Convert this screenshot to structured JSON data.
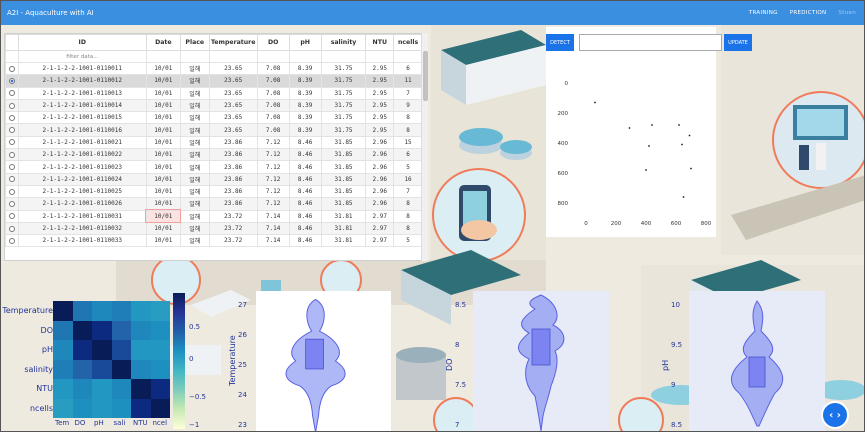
{
  "app": {
    "title": "A2I - Aquaculture with AI"
  },
  "nav": {
    "training": "TRAINING",
    "prediction": "PREDICTION",
    "user": "Stuen"
  },
  "table": {
    "columns": [
      "",
      "ID",
      "Date",
      "Place",
      "Temperature",
      "DO",
      "pH",
      "salinity",
      "NTU",
      "ncells"
    ],
    "filter_placeholder": "filter data...",
    "rows": [
      {
        "id": "2-1-1-2-2-1001-0110011",
        "date": "10/01",
        "place": "일해",
        "temperature": "23.65",
        "do": "7.08",
        "ph": "8.39",
        "salinity": "31.75",
        "ntu": "2.95",
        "ncells": "6"
      },
      {
        "id": "2-1-1-2-2-1001-0110012",
        "date": "10/01",
        "place": "일해",
        "temperature": "23.65",
        "do": "7.08",
        "ph": "8.39",
        "salinity": "31.75",
        "ntu": "2.95",
        "ncells": "11"
      },
      {
        "id": "2-1-1-2-2-1001-0110013",
        "date": "10/01",
        "place": "일해",
        "temperature": "23.65",
        "do": "7.08",
        "ph": "8.39",
        "salinity": "31.75",
        "ntu": "2.95",
        "ncells": "7"
      },
      {
        "id": "2-1-1-2-2-1001-0110014",
        "date": "10/01",
        "place": "일해",
        "temperature": "23.65",
        "do": "7.08",
        "ph": "8.39",
        "salinity": "31.75",
        "ntu": "2.95",
        "ncells": "9"
      },
      {
        "id": "2-1-1-2-2-1001-0110015",
        "date": "10/01",
        "place": "일해",
        "temperature": "23.65",
        "do": "7.08",
        "ph": "8.39",
        "salinity": "31.75",
        "ntu": "2.95",
        "ncells": "8"
      },
      {
        "id": "2-1-1-2-2-1001-0110016",
        "date": "10/01",
        "place": "일해",
        "temperature": "23.65",
        "do": "7.08",
        "ph": "8.39",
        "salinity": "31.75",
        "ntu": "2.95",
        "ncells": "8"
      },
      {
        "id": "2-1-1-2-2-1001-0110021",
        "date": "10/01",
        "place": "일해",
        "temperature": "23.86",
        "do": "7.12",
        "ph": "8.46",
        "salinity": "31.85",
        "ntu": "2.96",
        "ncells": "15"
      },
      {
        "id": "2-1-1-2-2-1001-0110022",
        "date": "10/01",
        "place": "일해",
        "temperature": "23.86",
        "do": "7.12",
        "ph": "8.46",
        "salinity": "31.85",
        "ntu": "2.96",
        "ncells": "6"
      },
      {
        "id": "2-1-1-2-2-1001-0110023",
        "date": "10/01",
        "place": "일해",
        "temperature": "23.86",
        "do": "7.12",
        "ph": "8.46",
        "salinity": "31.85",
        "ntu": "2.96",
        "ncells": "5"
      },
      {
        "id": "2-1-1-2-2-1001-0110024",
        "date": "10/01",
        "place": "일해",
        "temperature": "23.86",
        "do": "7.12",
        "ph": "8.46",
        "salinity": "31.85",
        "ntu": "2.96",
        "ncells": "16"
      },
      {
        "id": "2-1-1-2-2-1001-0110025",
        "date": "10/01",
        "place": "일해",
        "temperature": "23.86",
        "do": "7.12",
        "ph": "8.46",
        "salinity": "31.85",
        "ntu": "2.96",
        "ncells": "7"
      },
      {
        "id": "2-1-1-2-2-1001-0110026",
        "date": "10/01",
        "place": "일해",
        "temperature": "23.86",
        "do": "7.12",
        "ph": "8.46",
        "salinity": "31.85",
        "ntu": "2.96",
        "ncells": "8"
      },
      {
        "id": "2-1-1-2-2-1001-0110031",
        "date": "10/01",
        "place": "일해",
        "temperature": "23.72",
        "do": "7.14",
        "ph": "8.46",
        "salinity": "31.81",
        "ntu": "2.97",
        "ncells": "8"
      },
      {
        "id": "2-1-1-2-2-1001-0110032",
        "date": "10/01",
        "place": "일해",
        "temperature": "23.72",
        "do": "7.14",
        "ph": "8.46",
        "salinity": "31.81",
        "ntu": "2.97",
        "ncells": "8"
      },
      {
        "id": "2-1-1-2-2-1001-0110033",
        "date": "10/01",
        "place": "일해",
        "temperature": "23.72",
        "do": "7.14",
        "ph": "8.46",
        "salinity": "31.81",
        "ntu": "2.97",
        "ncells": "5"
      }
    ],
    "selected_row": 1
  },
  "detect": {
    "detect_label": "DETECT",
    "update_label": "UPDATE",
    "input_value": ""
  },
  "scatter": {
    "x_ticks": [
      "0",
      "200",
      "400",
      "600",
      "800"
    ],
    "y_ticks": [
      "0",
      "200",
      "400",
      "600",
      "800"
    ],
    "points": [
      [
        60,
        130
      ],
      [
        290,
        300
      ],
      [
        440,
        280
      ],
      [
        620,
        280
      ],
      [
        420,
        420
      ],
      [
        640,
        410
      ],
      [
        690,
        350
      ],
      [
        400,
        580
      ],
      [
        700,
        570
      ],
      [
        650,
        760
      ]
    ]
  },
  "heatmap": {
    "labels": [
      "Temperature",
      "DO",
      "pH",
      "salinity",
      "NTU",
      "ncells"
    ],
    "x_labels": [
      "Tem",
      "DO",
      "pH",
      "sali",
      "NTU",
      "ncel"
    ],
    "colorbar_ticks": [
      "0.5",
      "0",
      "−0.5",
      "−1"
    ],
    "values": [
      [
        1,
        0.3,
        0.2,
        0.25,
        0.1,
        0.05
      ],
      [
        0.3,
        1,
        0.75,
        0.4,
        0.2,
        0.15
      ],
      [
        0.2,
        0.75,
        1,
        0.55,
        0.1,
        0.1
      ],
      [
        0.25,
        0.4,
        0.55,
        1,
        0.2,
        0.15
      ],
      [
        0.1,
        0.2,
        0.1,
        0.2,
        1,
        0.75
      ],
      [
        0.05,
        0.15,
        0.1,
        0.15,
        0.75,
        1
      ]
    ]
  },
  "violins": [
    {
      "ylabel": "Temperature",
      "ticks": [
        "27",
        "26",
        "25",
        "24",
        "23"
      ]
    },
    {
      "ylabel": "DO",
      "ticks": [
        "8.5",
        "8",
        "7.5",
        "7"
      ]
    },
    {
      "ylabel": "pH",
      "ticks": [
        "10",
        "9.5",
        "9",
        "8.5"
      ]
    }
  ],
  "fab": {
    "label": "‹ ›"
  },
  "colors": {
    "nav": "#3b8fe0",
    "button": "#1a73e8",
    "violin": "#6e7df0"
  }
}
